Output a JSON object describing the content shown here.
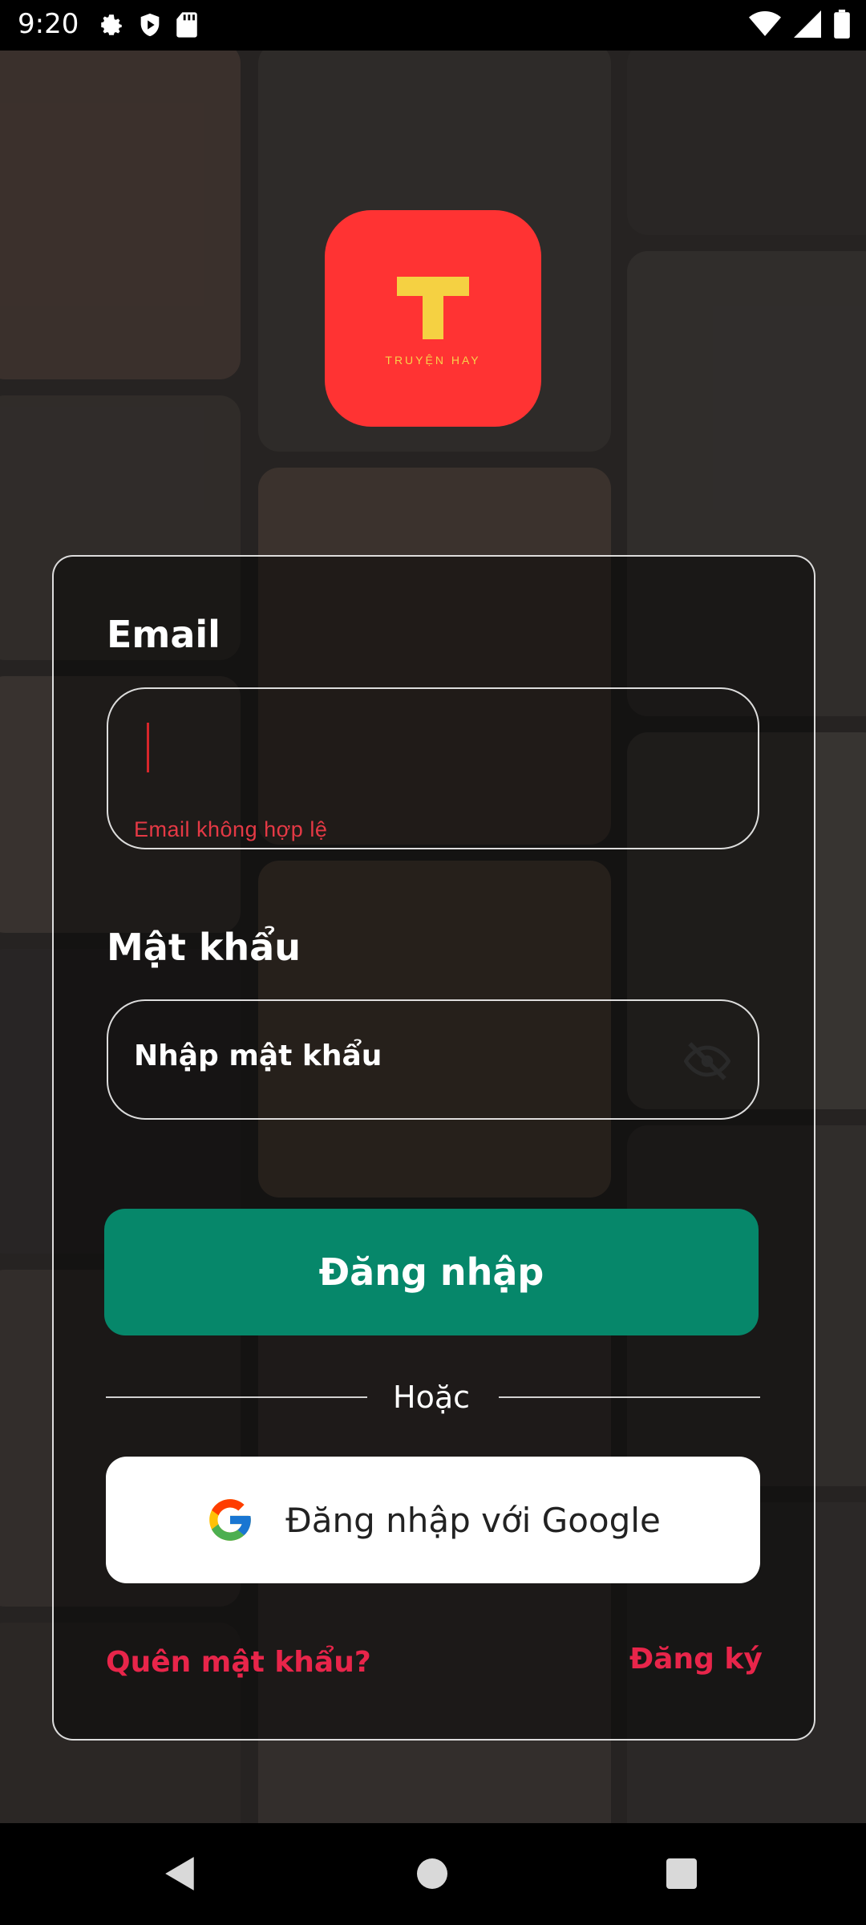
{
  "status_bar": {
    "time": "9:20",
    "left_icons": [
      "gear-icon",
      "shield-play-icon",
      "sd-card-icon"
    ],
    "right_icons": [
      "wifi-icon",
      "signal-icon",
      "battery-icon"
    ]
  },
  "app": {
    "logo_letter": "T",
    "logo_subtitle": "TRUYỆN HAY",
    "brand_color": "#ff3333",
    "logo_accent": "#f5d142"
  },
  "form": {
    "email_label": "Email",
    "email_value": "",
    "email_error": "Email không hợp lệ",
    "password_label": "Mật khẩu",
    "password_placeholder": "Nhập mật khẩu",
    "password_toggle_icon": "eye-off-icon"
  },
  "actions": {
    "login_label": "Đăng nhập",
    "login_color": "#06876a",
    "or_text": "Hoặc",
    "google_label": "Đăng nhập với Google",
    "google_icon": "google-icon",
    "forgot_password": "Quên mật khẩu?",
    "register": "Đăng ký",
    "link_color": "#e8254a"
  },
  "nav_bar": {
    "buttons": [
      "back-icon",
      "home-icon",
      "recents-icon"
    ]
  }
}
